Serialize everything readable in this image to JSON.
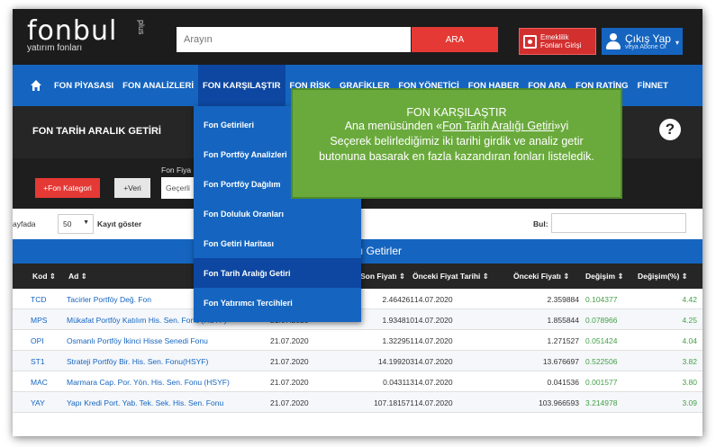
{
  "brand": {
    "logo": "fonbul",
    "logo_plus": "plus",
    "tagline": "yatırım fonları"
  },
  "search": {
    "placeholder": "Arayın",
    "button": "ARA"
  },
  "header_buttons": {
    "emeklilik_line1": "Emeklilik",
    "emeklilik_line2": "Fonları Girişi",
    "user_main": "Çıkış Yap",
    "user_sub": "veya Abone Ol"
  },
  "nav": {
    "items": [
      "FON PİYASASI",
      "FON ANALİZLERİ",
      "FON KARŞILAŞTIR",
      "FON RİSK",
      "GRAFİKLER",
      "FON YÖNETİCİ",
      "FON HABER",
      "FON ARA",
      "FON RATİNG",
      "FİNNET"
    ],
    "active_index": 2
  },
  "dropdown": {
    "items": [
      "Fon Getirileri",
      "Fon Portföy Analizleri",
      "Fon Portföy Dağılım",
      "Fon Doluluk Oranları",
      "Fon Getiri Haritası",
      "Fon Tarih Aralığı Getiri",
      "Fon Yatırımcı Tercihleri"
    ],
    "active_index": 5
  },
  "page": {
    "title": "FON TARİH ARALIK GETİRİ",
    "help": "?"
  },
  "filters": {
    "kategori_button": "+Fon Kategori",
    "veri_button": "+Veri",
    "fon_fiyat_label": "Fon Fiya",
    "getiri_select": "Geçerli"
  },
  "table_controls": {
    "sayfada": "ayfada",
    "page_size": "50",
    "kayit": "Kayıt göster",
    "bul": "Bul:"
  },
  "table": {
    "title": "sı Getirler",
    "headers": [
      "Kod",
      "Ad",
      "Son Fiyatı",
      "Önceki Fiyat Tarihi",
      "Önceki Fiyatı",
      "Değişim",
      "Değişim(%)"
    ],
    "rows": [
      [
        "TCD",
        "Tacirler Portföy Değ. Fon",
        "",
        "2.464261",
        "14.07.2020",
        "2.359884",
        "0.104377",
        "4.42"
      ],
      [
        "MPS",
        "Mükafat Portföy Katılım His. Sen. Fonu (HSYF)",
        "21.07.2020",
        "1.934810",
        "14.07.2020",
        "1.855844",
        "0.078966",
        "4.25"
      ],
      [
        "OPI",
        "Osmanlı Portföy İkinci Hisse Senedi Fonu",
        "21.07.2020",
        "1.322951",
        "14.07.2020",
        "1.271527",
        "0.051424",
        "4.04"
      ],
      [
        "ST1",
        "Strateji Portföy Bir. His. Sen. Fonu(HSYF)",
        "21.07.2020",
        "14.199203",
        "14.07.2020",
        "13.676697",
        "0.522506",
        "3.82"
      ],
      [
        "MAC",
        "Marmara Cap. Por. Yön. His. Sen. Fonu (HSYF)",
        "21.07.2020",
        "0.043113",
        "14.07.2020",
        "0.041536",
        "0.001577",
        "3.80"
      ],
      [
        "YAY",
        "Yapı Kredi Port. Yab. Tek. Sek. His. Sen. Fonu",
        "21.07.2020",
        "107.181571",
        "14.07.2020",
        "103.966593",
        "3.214978",
        "3.09"
      ]
    ]
  },
  "annotation": {
    "title": "FON KARŞILAŞTIR",
    "line1_prefix": "Ana menüsünden «",
    "line1_link": "Fon Tarih Aralığı Getiri",
    "line1_suffix": "»yi",
    "line2": "Seçerek belirlediğimiz iki tarihi girdik ve analiz getir",
    "line3": "butonuna basarak en fazla kazandıran fonları listeledik."
  },
  "colors": {
    "nav_blue": "#1565c0",
    "active_blue": "#0d47a1",
    "red": "#e53935",
    "dark": "#1c1c1c",
    "annotation_green": "#6aaa3c",
    "positive_green": "#43a047"
  }
}
